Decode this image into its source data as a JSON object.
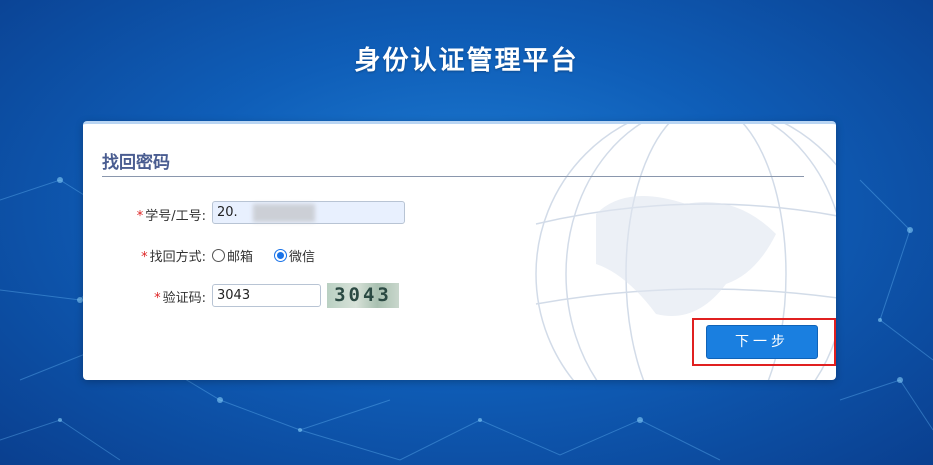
{
  "header": {
    "title": "身份认证管理平台"
  },
  "panel": {
    "title": "找回密码"
  },
  "form": {
    "student_id": {
      "required_mark": "*",
      "label": "学号/工号:",
      "value": "20."
    },
    "recovery": {
      "required_mark": "*",
      "label": "找回方式:",
      "options": [
        {
          "label": "邮箱",
          "checked": false
        },
        {
          "label": "微信",
          "checked": true
        }
      ]
    },
    "captcha": {
      "required_mark": "*",
      "label": "验证码:",
      "value": "3043",
      "image_text": "3043"
    }
  },
  "actions": {
    "next_label": "下一步"
  },
  "colors": {
    "primary_button": "#1a7fe0",
    "highlight_border": "#e02020",
    "panel_title": "#4a5d91"
  }
}
